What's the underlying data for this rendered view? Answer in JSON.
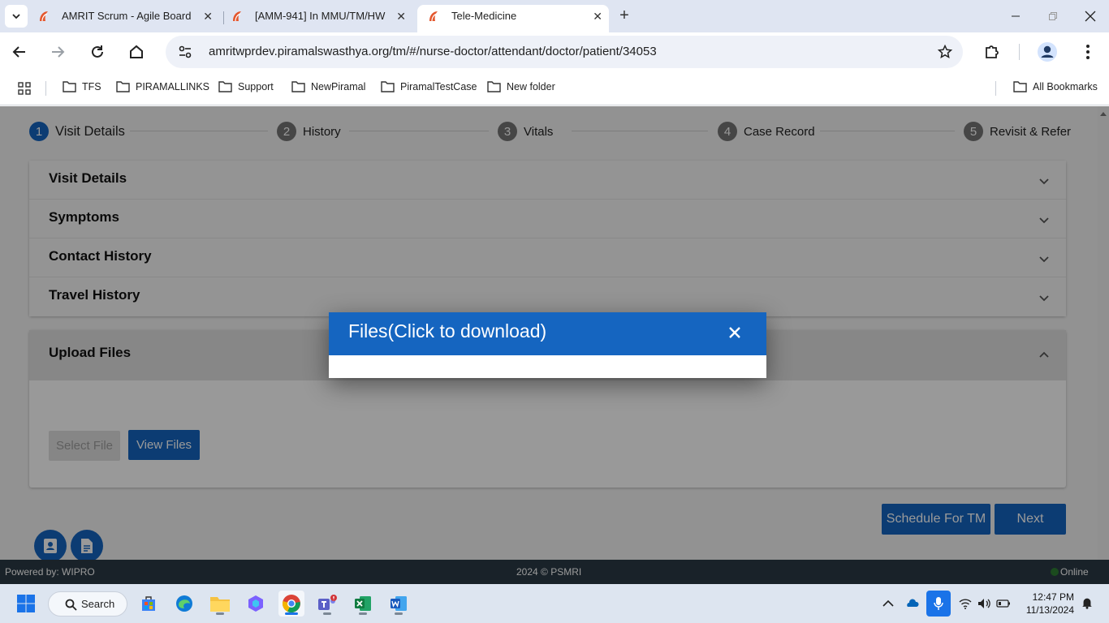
{
  "browser": {
    "tabs": [
      {
        "title": "AMRIT Scrum - Agile Board"
      },
      {
        "title": "[AMM-941] In MMU/TM/HW"
      },
      {
        "title": "Tele-Medicine"
      }
    ],
    "url": "amritwprdev.piramalswasthya.org/tm/#/nurse-doctor/attendant/doctor/patient/34053",
    "bookmarks": [
      "TFS",
      "PIRAMALLINKS",
      "Support",
      "NewPiramal",
      "PiramalTestCase",
      "New folder"
    ],
    "all_bookmarks": "All Bookmarks"
  },
  "stepper": [
    {
      "num": "1",
      "label": "Visit Details"
    },
    {
      "num": "2",
      "label": "History"
    },
    {
      "num": "3",
      "label": "Vitals"
    },
    {
      "num": "4",
      "label": "Case Record"
    },
    {
      "num": "5",
      "label": "Revisit & Refer"
    }
  ],
  "sections": [
    "Visit Details",
    "Symptoms",
    "Contact History",
    "Travel History"
  ],
  "upload": {
    "title": "Upload Files",
    "select_file": "Select File",
    "view_files": "View Files"
  },
  "actions": {
    "schedule": "Schedule For TM",
    "next": "Next"
  },
  "footer": {
    "powered": "Powered by: WIPRO",
    "copyright": "2024 © PSMRI",
    "status": "Online"
  },
  "dialog": {
    "title": "Files(Click to download)"
  },
  "taskbar": {
    "search": "Search",
    "time": "12:47 PM",
    "date": "11/13/2024"
  },
  "colors": {
    "primary": "#1565c0",
    "online": "#2e7d32"
  }
}
